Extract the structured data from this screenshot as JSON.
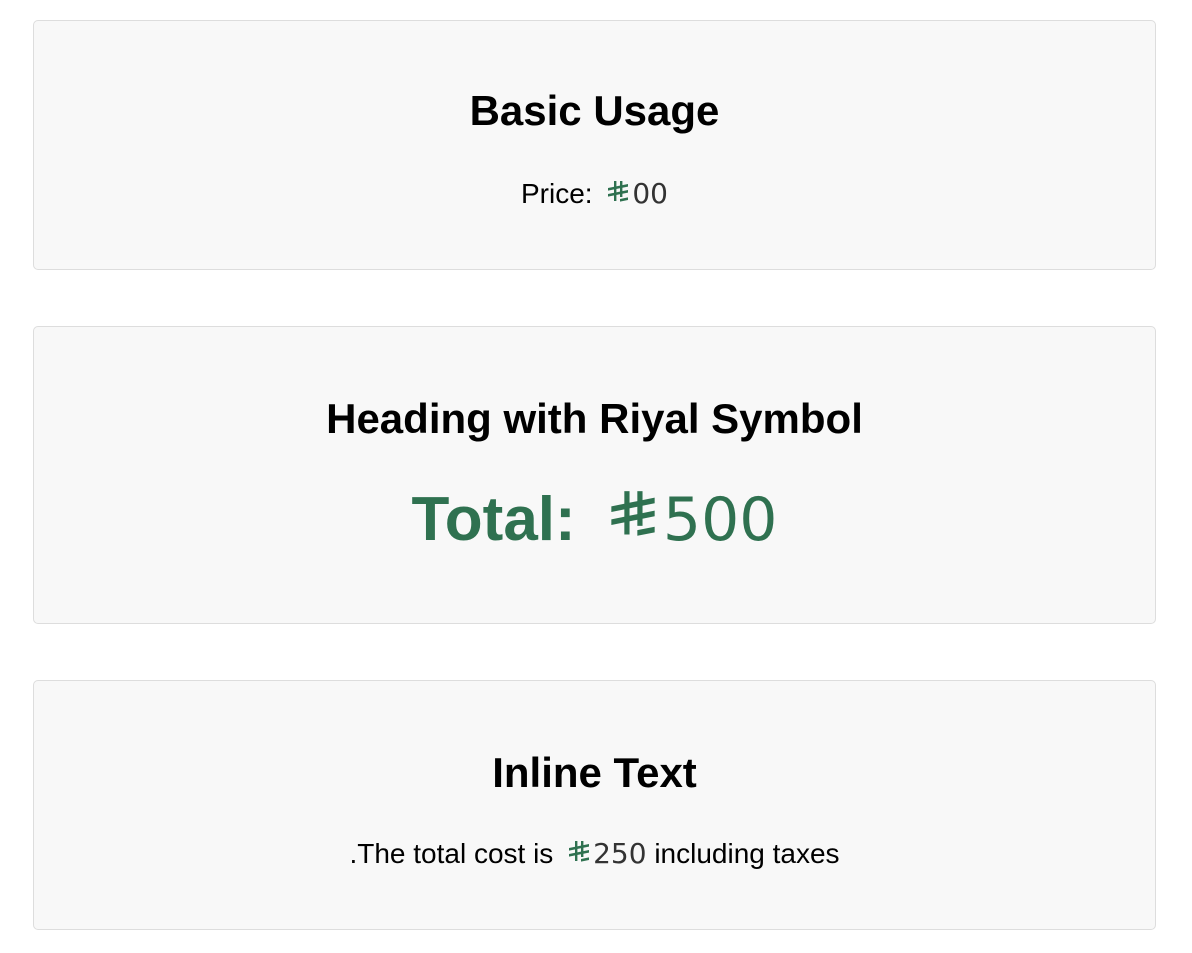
{
  "colors": {
    "accent": "#2f7150",
    "card_bg": "#f8f8f8",
    "card_border": "#dddddd"
  },
  "sections": [
    {
      "heading": "Basic Usage",
      "label": "Price:",
      "symbol": "riyal-sign-icon",
      "amount": "00"
    },
    {
      "heading": "Heading with Riyal Symbol",
      "label": "Total:",
      "symbol": "riyal-sign-icon",
      "amount": "500"
    },
    {
      "heading": "Inline Text",
      "prefix": ".The total cost is",
      "symbol": "riyal-sign-icon",
      "amount": "250",
      "suffix": "including taxes"
    }
  ]
}
